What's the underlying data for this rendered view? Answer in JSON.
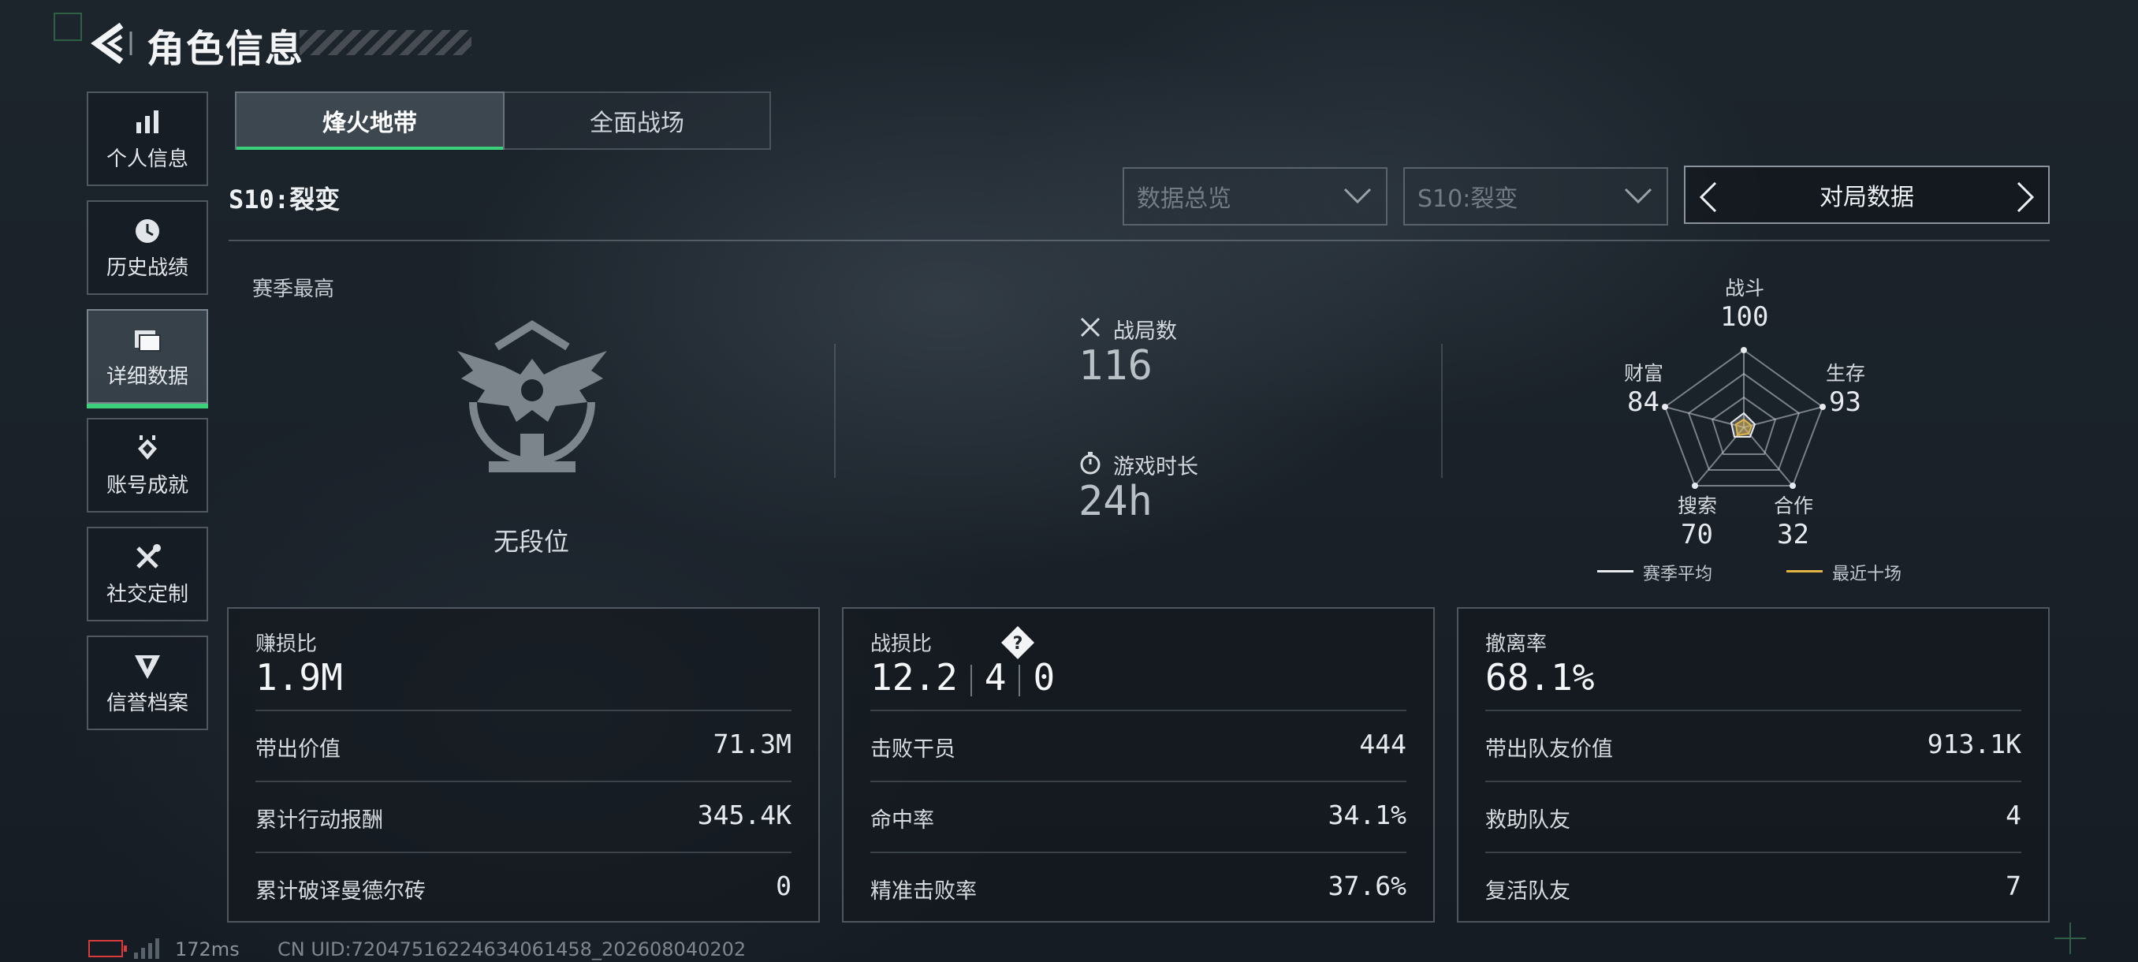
{
  "header": {
    "title": "角色信息",
    "back_icon": "back-arrow-icon"
  },
  "nav": {
    "items": [
      {
        "label": "个人信息",
        "icon": "bar-chart-icon",
        "active": false
      },
      {
        "label": "历史战绩",
        "icon": "history-clock-icon",
        "active": false
      },
      {
        "label": "详细数据",
        "icon": "folder-icon",
        "active": true
      },
      {
        "label": "账号成就",
        "icon": "achievement-icon",
        "active": false
      },
      {
        "label": "社交定制",
        "icon": "tools-icon",
        "active": false
      },
      {
        "label": "信誉档案",
        "icon": "reputation-badge-icon",
        "active": false
      }
    ]
  },
  "tabs": [
    {
      "label": "烽火地带",
      "active": true
    },
    {
      "label": "全面战场",
      "active": false
    }
  ],
  "season_label": "S10:裂变",
  "filters": {
    "data_dropdown": "数据总览",
    "season_dropdown": "S10:裂变",
    "switcher_label": "对局数据"
  },
  "rank": {
    "label": "赛季最高",
    "name": "无段位"
  },
  "stats": {
    "matches": {
      "label": "战局数",
      "value": "116"
    },
    "playtime": {
      "label": "游戏时长",
      "value": "24h"
    }
  },
  "radar": {
    "axes": [
      {
        "label": "战斗",
        "value": "100"
      },
      {
        "label": "生存",
        "value": "93"
      },
      {
        "label": "合作",
        "value": "32"
      },
      {
        "label": "搜索",
        "value": "70"
      },
      {
        "label": "财富",
        "value": "84"
      }
    ],
    "legend": [
      {
        "label": "赛季平均",
        "color": "#e8ecef"
      },
      {
        "label": "最近十场",
        "color": "#e2b545"
      }
    ]
  },
  "panels": {
    "profit": {
      "title": "赚损比",
      "value": "1.9M",
      "rows": [
        {
          "label": "带出价值",
          "value": "71.3M"
        },
        {
          "label": "累计行动报酬",
          "value": "345.4K"
        },
        {
          "label": "累计破译曼德尔砖",
          "value": "0"
        }
      ]
    },
    "kd": {
      "title": "战损比",
      "value": "12.2",
      "v2": "4",
      "v3": "0",
      "rows": [
        {
          "label": "击败干员",
          "value": "444"
        },
        {
          "label": "命中率",
          "value": "34.1%"
        },
        {
          "label": "精准击败率",
          "value": "37.6%"
        }
      ]
    },
    "extract": {
      "title": "撤离率",
      "value": "68.1%",
      "rows": [
        {
          "label": "带出队友价值",
          "value": "913.1K"
        },
        {
          "label": "救助队友",
          "value": "4"
        },
        {
          "label": "复活队友",
          "value": "7"
        }
      ]
    }
  },
  "footer": {
    "ping": "172ms",
    "uid": "CN UID:72047516224634061458_202608040202"
  }
}
